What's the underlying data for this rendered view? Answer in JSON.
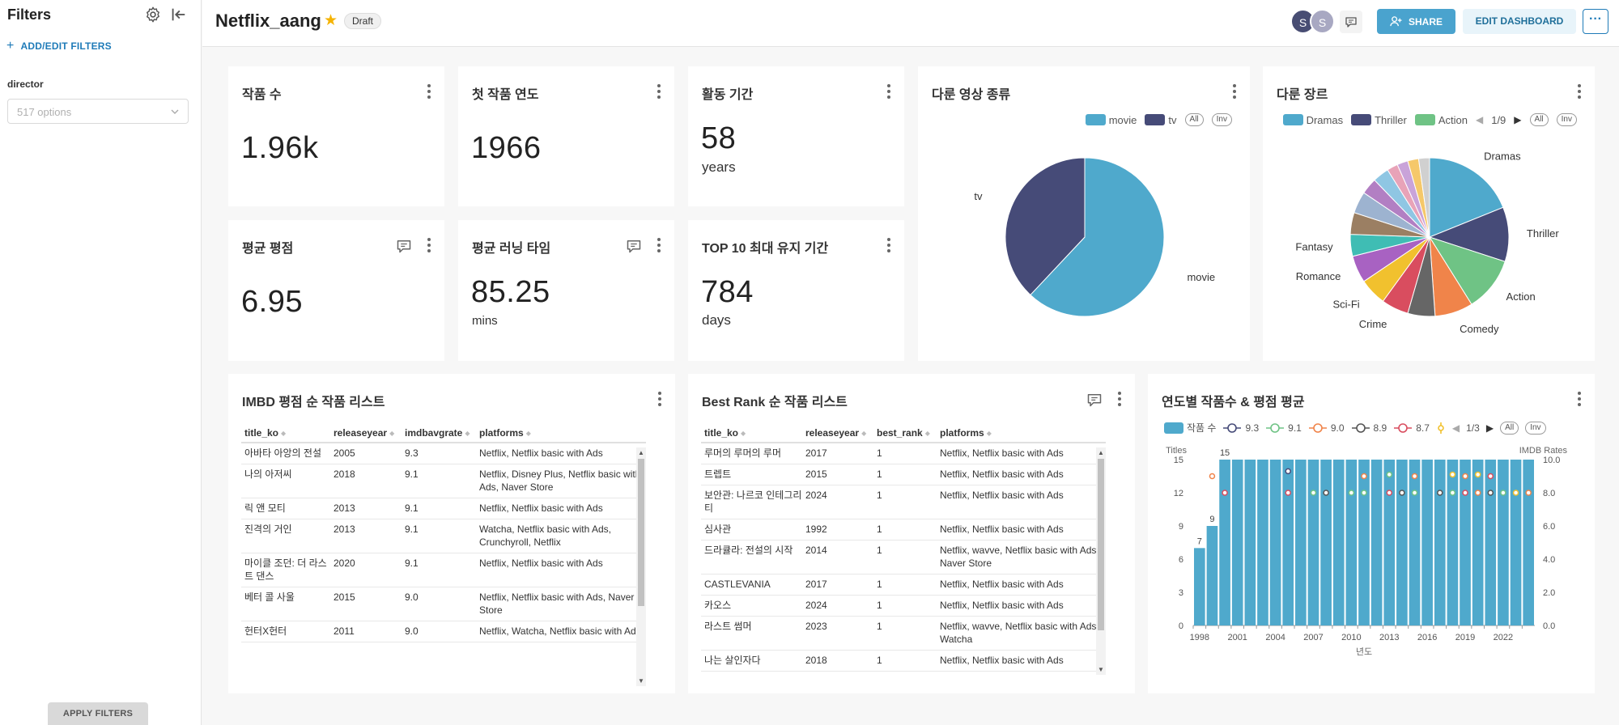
{
  "sidebar": {
    "title": "Filters",
    "add_filters": "ADD/EDIT FILTERS",
    "filter_label": "director",
    "filter_placeholder": "517 options",
    "apply": "APPLY FILTERS"
  },
  "header": {
    "title": "Netflix_aang",
    "badge": "Draft",
    "avatars": [
      "S",
      "S"
    ],
    "share": "SHARE",
    "edit": "EDIT DASHBOARD"
  },
  "kpis": {
    "count": {
      "title": "작품 수",
      "value": "1.96k"
    },
    "first_year": {
      "title": "첫 작품 연도",
      "value": "1966"
    },
    "active": {
      "title": "활동 기간",
      "value": "58",
      "unit": "years"
    },
    "rating": {
      "title": "평균 평점",
      "value": "6.95"
    },
    "runtime": {
      "title": "평균 러닝 타임",
      "value": "85.25",
      "unit": "mins"
    },
    "top10": {
      "title": "TOP 10 최대 유지 기간",
      "value": "784",
      "unit": "days"
    }
  },
  "type_pie": {
    "title": "다룬 영상 종류",
    "legend": [
      {
        "name": "movie",
        "color": "#4fa9cc"
      },
      {
        "name": "tv",
        "color": "#464b78"
      }
    ],
    "all": "All",
    "inv": "Inv"
  },
  "genre_pie": {
    "title": "다룬 장르",
    "legend": [
      {
        "name": "Dramas",
        "color": "#4fa9cc"
      },
      {
        "name": "Thriller",
        "color": "#464b78"
      },
      {
        "name": "Action",
        "color": "#6fc385"
      }
    ],
    "page": "1/9",
    "all": "All",
    "inv": "Inv"
  },
  "imdb_table": {
    "title": "IMBD 평점 순 작품 리스트",
    "columns": [
      "title_ko",
      "releaseyear",
      "imdbavgrate",
      "platforms"
    ],
    "rows": [
      [
        "아바타 아앙의 전설",
        "2005",
        "9.3",
        "Netflix, Netflix basic with Ads"
      ],
      [
        "나의 아저씨",
        "2018",
        "9.1",
        "Netflix, Disney Plus, Netflix basic with Ads, Naver Store"
      ],
      [
        "릭 앤 모티",
        "2013",
        "9.1",
        "Netflix, Netflix basic with Ads"
      ],
      [
        "진격의 거인",
        "2013",
        "9.1",
        "Watcha, Netflix basic with Ads, Crunchyroll, Netflix"
      ],
      [
        "마이클 조던: 더 라스트 댄스",
        "2020",
        "9.1",
        "Netflix, Netflix basic with Ads"
      ],
      [
        "베터 콜 사울",
        "2015",
        "9.0",
        "Netflix, Netflix basic with Ads, Naver Store"
      ],
      [
        "헌터X헌터",
        "2011",
        "9.0",
        "Netflix, Watcha, Netflix basic with Ads"
      ]
    ]
  },
  "rank_table": {
    "title": "Best Rank 순 작품 리스트",
    "columns": [
      "title_ko",
      "releaseyear",
      "best_rank",
      "platforms"
    ],
    "rows": [
      [
        "루머의 루머의 루머",
        "2017",
        "1",
        "Netflix, Netflix basic with Ads"
      ],
      [
        "트렙트",
        "2015",
        "1",
        "Netflix, Netflix basic with Ads"
      ],
      [
        "보안관: 나르코 인테그리티",
        "2024",
        "1",
        "Netflix, Netflix basic with Ads"
      ],
      [
        "심사관",
        "1992",
        "1",
        "Netflix, Netflix basic with Ads"
      ],
      [
        "드라큘라: 전설의 시작",
        "2014",
        "1",
        "Netflix, wavve, Netflix basic with Ads, Naver Store"
      ],
      [
        "CASTLEVANIA",
        "2017",
        "1",
        "Netflix, Netflix basic with Ads"
      ],
      [
        "카오스",
        "2024",
        "1",
        "Netflix, Netflix basic with Ads"
      ],
      [
        "라스트 썸머",
        "2023",
        "1",
        "Netflix, wavve, Netflix basic with Ads, Watcha"
      ],
      [
        "나는 살인자다",
        "2018",
        "1",
        "Netflix, Netflix basic with Ads"
      ]
    ]
  },
  "combo": {
    "title": "연도별 작품수 & 평점 평균",
    "legend": [
      {
        "name": "작품 수",
        "color": "#4fa9cc",
        "kind": "bar"
      },
      {
        "name": "9.3",
        "color": "#464b78",
        "kind": "dot"
      },
      {
        "name": "9.1",
        "color": "#6fc385",
        "kind": "dot"
      },
      {
        "name": "9.0",
        "color": "#f0844a",
        "kind": "dot"
      },
      {
        "name": "8.9",
        "color": "#555555",
        "kind": "dot"
      },
      {
        "name": "8.7",
        "color": "#d94d5f",
        "kind": "dot"
      }
    ],
    "page": "1/3",
    "all": "All",
    "inv": "Inv"
  },
  "chart_data": [
    {
      "type": "pie",
      "title": "다룬 영상 종류",
      "labels": [
        "movie",
        "tv"
      ],
      "values": [
        62,
        38
      ],
      "colors": [
        "#4fa9cc",
        "#464b78"
      ]
    },
    {
      "type": "pie",
      "title": "다룬 장르",
      "labels": [
        "Dramas",
        "Thriller",
        "Action",
        "Comedy",
        "",
        "Crime",
        "Sci-Fi",
        "Romance",
        "Fantasy",
        "",
        "",
        "",
        "",
        "",
        "",
        "",
        ""
      ],
      "values": [
        17,
        10,
        10,
        7,
        5,
        5,
        5,
        5,
        4,
        4,
        4,
        3,
        3,
        2,
        2,
        2,
        2
      ],
      "colors": [
        "#4fa9cc",
        "#464b78",
        "#6fc385",
        "#f0844a",
        "#666666",
        "#d94d5f",
        "#f1c12e",
        "#a862c2",
        "#3fbdb4",
        "#9b7f63",
        "#9db3d0",
        "#b27fc3",
        "#8fc6e3",
        "#e8a3b8",
        "#c9a3d9",
        "#f5c86a",
        "#d0d0d0"
      ]
    },
    {
      "type": "bar",
      "title": "연도별 작품수 & 평점 평균",
      "xlabel": "년도",
      "ylabel": "Titles",
      "ylabel_right": "IMDB Rates",
      "ylim": [
        0,
        15
      ],
      "ylim_right": [
        0,
        10
      ],
      "yticks": [
        0,
        3,
        6,
        9,
        12,
        15
      ],
      "yticks_right": [
        "0.0",
        "2.0",
        "4.0",
        "6.0",
        "8.0",
        "10.0"
      ],
      "xtick_labels": [
        "1998",
        "2001",
        "2004",
        "2007",
        "2010",
        "2013",
        "2016",
        "2019",
        "2022"
      ],
      "categories": [
        "1998",
        "1999",
        "2000",
        "2001",
        "2002",
        "2003",
        "2004",
        "2005",
        "2006",
        "2007",
        "2008",
        "2009",
        "2010",
        "2011",
        "2012",
        "2013",
        "2014",
        "2015",
        "2016",
        "2017",
        "2018",
        "2019",
        "2020",
        "2021",
        "2022",
        "2023",
        "2024"
      ],
      "series": [
        {
          "name": "작품 수",
          "values": [
            7,
            9,
            15,
            15,
            15,
            15,
            15,
            15,
            15,
            15,
            15,
            15,
            15,
            15,
            15,
            15,
            15,
            15,
            15,
            15,
            15,
            15,
            15,
            15,
            15,
            15,
            15
          ]
        }
      ],
      "bar_labels": {
        "1998": "7",
        "1999": "9",
        "2000": "15"
      },
      "rate_points": [
        {
          "year": "1999",
          "rate": 9.0,
          "color": "#f0844a"
        },
        {
          "year": "2000",
          "rate": 8.0,
          "color": "#d94d5f"
        },
        {
          "year": "2005",
          "rate": 9.3,
          "color": "#464b78"
        },
        {
          "year": "2005",
          "rate": 8.0,
          "color": "#d94d5f"
        },
        {
          "year": "2007",
          "rate": 8.0,
          "color": "#6fc385"
        },
        {
          "year": "2008",
          "rate": 8.0,
          "color": "#555555"
        },
        {
          "year": "2010",
          "rate": 8.0,
          "color": "#6fc385"
        },
        {
          "year": "2011",
          "rate": 9.0,
          "color": "#f0844a"
        },
        {
          "year": "2011",
          "rate": 8.0,
          "color": "#6fc385"
        },
        {
          "year": "2013",
          "rate": 9.1,
          "color": "#6fc385"
        },
        {
          "year": "2013",
          "rate": 8.0,
          "color": "#d94d5f"
        },
        {
          "year": "2014",
          "rate": 8.0,
          "color": "#555555"
        },
        {
          "year": "2015",
          "rate": 9.0,
          "color": "#f0844a"
        },
        {
          "year": "2015",
          "rate": 8.0,
          "color": "#6fc385"
        },
        {
          "year": "2017",
          "rate": 8.0,
          "color": "#555555"
        },
        {
          "year": "2018",
          "rate": 9.1,
          "color": "#f1c12e"
        },
        {
          "year": "2018",
          "rate": 8.0,
          "color": "#6fc385"
        },
        {
          "year": "2019",
          "rate": 9.0,
          "color": "#f0844a"
        },
        {
          "year": "2019",
          "rate": 8.0,
          "color": "#d94d5f"
        },
        {
          "year": "2020",
          "rate": 9.1,
          "color": "#f1c12e"
        },
        {
          "year": "2020",
          "rate": 8.0,
          "color": "#f0844a"
        },
        {
          "year": "2021",
          "rate": 9.0,
          "color": "#d94d5f"
        },
        {
          "year": "2021",
          "rate": 8.0,
          "color": "#555555"
        },
        {
          "year": "2022",
          "rate": 8.0,
          "color": "#6fc385"
        },
        {
          "year": "2023",
          "rate": 8.0,
          "color": "#f1c12e"
        },
        {
          "year": "2024",
          "rate": 8.0,
          "color": "#f0844a"
        }
      ]
    }
  ]
}
